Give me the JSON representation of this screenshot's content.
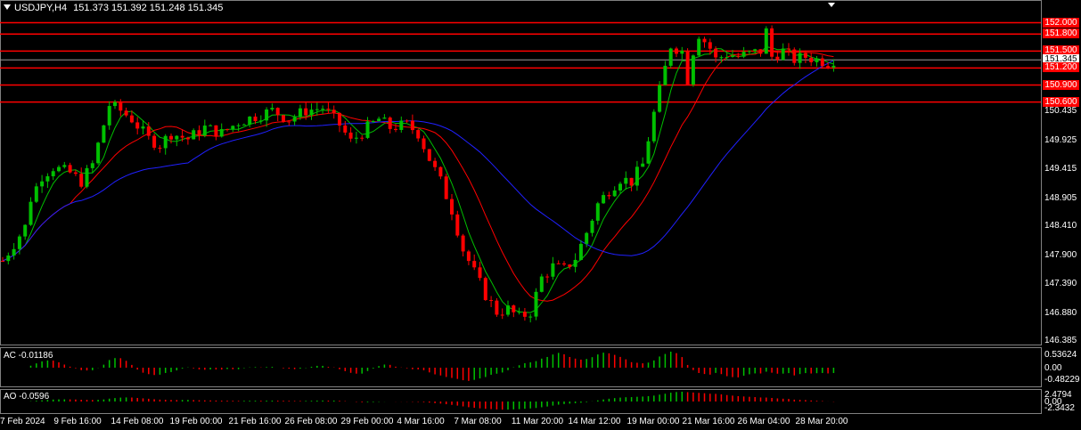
{
  "header": {
    "symbol": "USDJPY,H4",
    "ohlc": "151.373 151.392 151.248 151.345"
  },
  "current_price": "151.345",
  "colors": {
    "bull": "#00c000",
    "bear": "#ff0000",
    "ma_fast": "#00c000",
    "ma_mid": "#ff0000",
    "ma_slow": "#2020ff",
    "levels": "#ff0000"
  },
  "indicators": {
    "ac": {
      "label": "AC -0.01186",
      "ticks": [
        "0.53624",
        "0.00",
        "-0.48229"
      ]
    },
    "ao": {
      "label": "AO -0.0596",
      "ticks": [
        "2.4794",
        "0.00",
        "-2.3432"
      ]
    }
  },
  "price_ticks": [
    "152.000",
    "151.800",
    "151.500",
    "151.345",
    "151.200",
    "150.900",
    "150.600",
    "150.435",
    "149.925",
    "149.415",
    "148.905",
    "148.410",
    "147.900",
    "147.390",
    "146.880",
    "146.385"
  ],
  "time_ticks": [
    "7 Feb 2024",
    "9 Feb 16:00",
    "14 Feb 08:00",
    "19 Feb 00:00",
    "21 Feb 16:00",
    "26 Feb 08:00",
    "29 Feb 00:00",
    "4 Mar 16:00",
    "7 Mar 08:00",
    "11 Mar 20:00",
    "14 Mar 12:00",
    "19 Mar 00:00",
    "21 Mar 16:00",
    "26 Mar 04:00",
    "28 Mar 20:00"
  ],
  "chart_data": {
    "type": "candlestick",
    "symbol": "USDJPY",
    "timeframe": "H4",
    "ylim": [
      146.34,
      152.18
    ],
    "levels": [
      152.0,
      151.8,
      151.5,
      151.2,
      150.9,
      150.6
    ],
    "price_path": [
      [
        0,
        147.8
      ],
      [
        2,
        148.1
      ],
      [
        4,
        148.4
      ],
      [
        5,
        148.9
      ],
      [
        7,
        149.3
      ],
      [
        9,
        149.45
      ],
      [
        12,
        149.35
      ],
      [
        14,
        149.2
      ],
      [
        16,
        149.5
      ],
      [
        18,
        150.2
      ],
      [
        19,
        150.55
      ],
      [
        21,
        150.45
      ],
      [
        23,
        150.3
      ],
      [
        26,
        149.95
      ],
      [
        28,
        149.85
      ],
      [
        30,
        150.05
      ],
      [
        33,
        149.95
      ],
      [
        36,
        150.15
      ],
      [
        39,
        150.05
      ],
      [
        42,
        150.25
      ],
      [
        45,
        150.35
      ],
      [
        48,
        150.45
      ],
      [
        51,
        150.3
      ],
      [
        54,
        150.45
      ],
      [
        57,
        150.5
      ],
      [
        60,
        150.2
      ],
      [
        62,
        149.9
      ],
      [
        65,
        150.15
      ],
      [
        67,
        150.3
      ],
      [
        69,
        150.15
      ],
      [
        72,
        150.2
      ],
      [
        74,
        150.05
      ],
      [
        76,
        149.6
      ],
      [
        78,
        149.2
      ],
      [
        80,
        148.7
      ],
      [
        82,
        148.0
      ],
      [
        84,
        147.6
      ],
      [
        86,
        147.2
      ],
      [
        88,
        146.9
      ],
      [
        90,
        146.95
      ],
      [
        92,
        146.8
      ],
      [
        94,
        146.9
      ],
      [
        96,
        147.5
      ],
      [
        98,
        147.7
      ],
      [
        100,
        147.65
      ],
      [
        102,
        147.85
      ],
      [
        104,
        148.3
      ],
      [
        106,
        148.8
      ],
      [
        108,
        149.05
      ],
      [
        110,
        149.25
      ],
      [
        112,
        149.2
      ],
      [
        114,
        149.5
      ],
      [
        116,
        150.4
      ],
      [
        118,
        151.2
      ],
      [
        119,
        151.6
      ],
      [
        121,
        151.5
      ],
      [
        122,
        151.0
      ],
      [
        123,
        151.5
      ],
      [
        124,
        151.8
      ],
      [
        126,
        151.55
      ],
      [
        127,
        151.35
      ],
      [
        129,
        151.45
      ],
      [
        131,
        151.4
      ],
      [
        133,
        151.45
      ],
      [
        135,
        151.5
      ],
      [
        136,
        151.85
      ],
      [
        137,
        151.4
      ],
      [
        139,
        151.5
      ],
      [
        141,
        151.35
      ],
      [
        143,
        151.4
      ],
      [
        145,
        151.35
      ],
      [
        147,
        151.3
      ],
      [
        148,
        151.35
      ]
    ],
    "ma_periods": {
      "fast": 5,
      "mid": 13,
      "slow": 34
    },
    "ac": {
      "range": [
        -0.48229,
        0.53624
      ],
      "last": -0.01186
    },
    "ao": {
      "range": [
        -2.3432,
        2.4794
      ],
      "last": -0.0596
    }
  }
}
